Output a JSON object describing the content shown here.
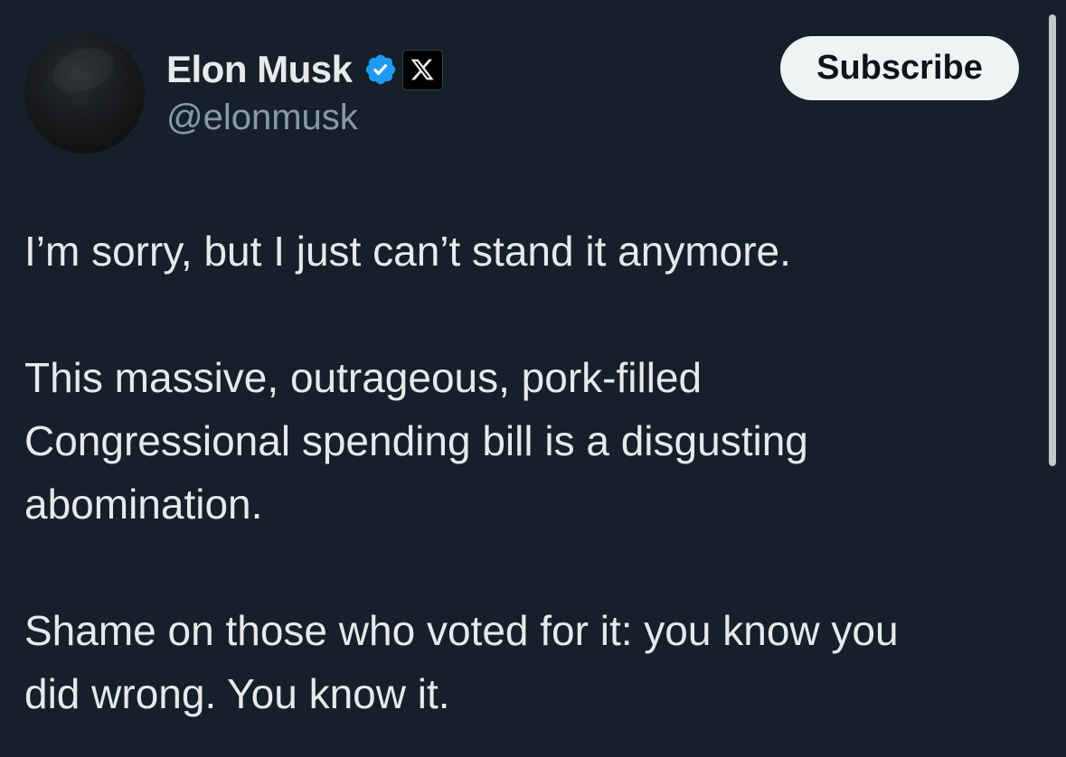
{
  "header": {
    "display_name": "Elon Musk",
    "handle": "@elonmusk",
    "verified_icon": "verified-badge-icon",
    "affiliation_icon": "x-logo-icon",
    "subscribe_label": "Subscribe"
  },
  "tweet": {
    "paragraphs": [
      {
        "lines": [
          "I’m sorry, but I just can’t stand it anymore."
        ]
      },
      {
        "lines": [
          "This massive, outrageous, pork-filled",
          "Congressional spending bill is a disgusting",
          "abomination."
        ]
      },
      {
        "lines": [
          "Shame on those who voted for it: you know you",
          "did wrong. You know it."
        ]
      }
    ]
  },
  "colors": {
    "background": "#15202b",
    "text": "#e7e9ea",
    "muted": "#8b98a5",
    "verified_blue": "#1d9bf0",
    "button_bg": "#eff3f4"
  }
}
